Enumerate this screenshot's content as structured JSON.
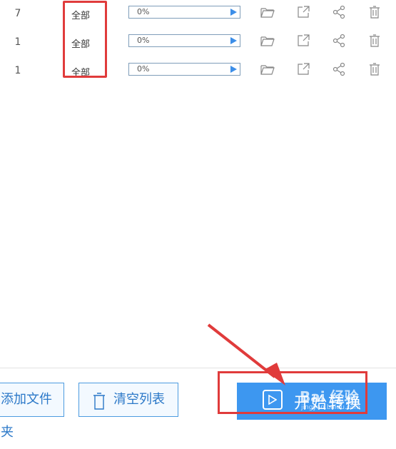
{
  "rows": [
    {
      "count": "7",
      "pages": "全部",
      "progress": "0%"
    },
    {
      "count": "1",
      "pages": "全部",
      "progress": "0%"
    },
    {
      "count": "1",
      "pages": "全部",
      "progress": "0%"
    }
  ],
  "toolbar": {
    "add_folder_label": "添加文件夹",
    "clear_list_label": "清空列表",
    "start_label": "开始转换"
  },
  "colors": {
    "accent": "#3d97f0",
    "highlight": "#e03b3b",
    "progress_border": "#7f9db9"
  },
  "icons": [
    "folder-icon",
    "open-external-icon",
    "share-icon",
    "delete-icon",
    "trash-icon",
    "play-icon"
  ],
  "watermark": {
    "text": "Bai 经验",
    "sub": "jingyan.baidu.com"
  }
}
